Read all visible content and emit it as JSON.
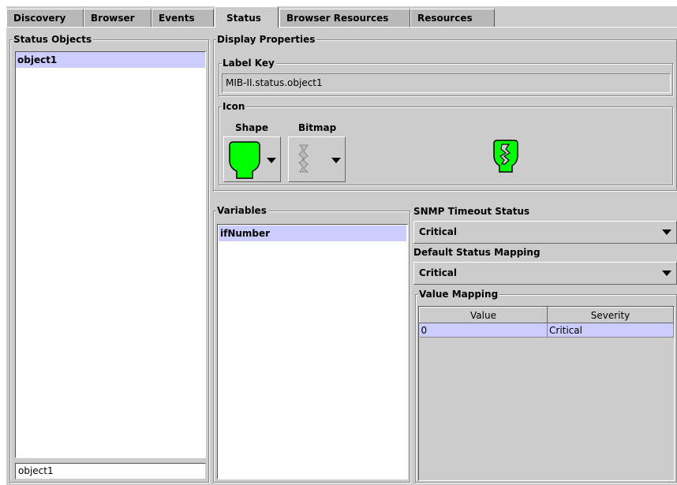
{
  "tabs": [
    {
      "label": "Discovery",
      "active": false
    },
    {
      "label": "Browser",
      "active": false
    },
    {
      "label": "Events",
      "active": false
    },
    {
      "label": "Status",
      "active": true
    },
    {
      "label": "Browser Resources",
      "active": false
    },
    {
      "label": "Resources",
      "active": false
    }
  ],
  "status_objects": {
    "title": "Status Objects",
    "items": [
      "object1"
    ],
    "selected": "object1",
    "name_field_value": "object1"
  },
  "display_properties": {
    "title": "Display Properties",
    "label_key": {
      "title": "Label Key",
      "value": "MIB-II.status.object1"
    },
    "icon": {
      "title": "Icon",
      "shape_label": "Shape",
      "bitmap_label": "Bitmap",
      "shape_icon": "green-shield-shape-icon",
      "bitmap_icon": "grey-link-bitmap-icon",
      "preview_icon": "green-shield-link-preview-icon"
    }
  },
  "variables": {
    "title": "Variables",
    "items": [
      "ifNumber"
    ]
  },
  "snmp_timeout_status": {
    "title": "SNMP Timeout Status",
    "value": "Critical"
  },
  "default_status_mapping": {
    "title": "Default Status Mapping",
    "value": "Critical"
  },
  "value_mapping": {
    "title": "Value Mapping",
    "columns": [
      "Value",
      "Severity"
    ],
    "rows": [
      [
        "0",
        "Critical"
      ]
    ]
  },
  "colors": {
    "background": "#cccccc",
    "selection": "#ccccff",
    "shape_fill": "#00ff00"
  }
}
